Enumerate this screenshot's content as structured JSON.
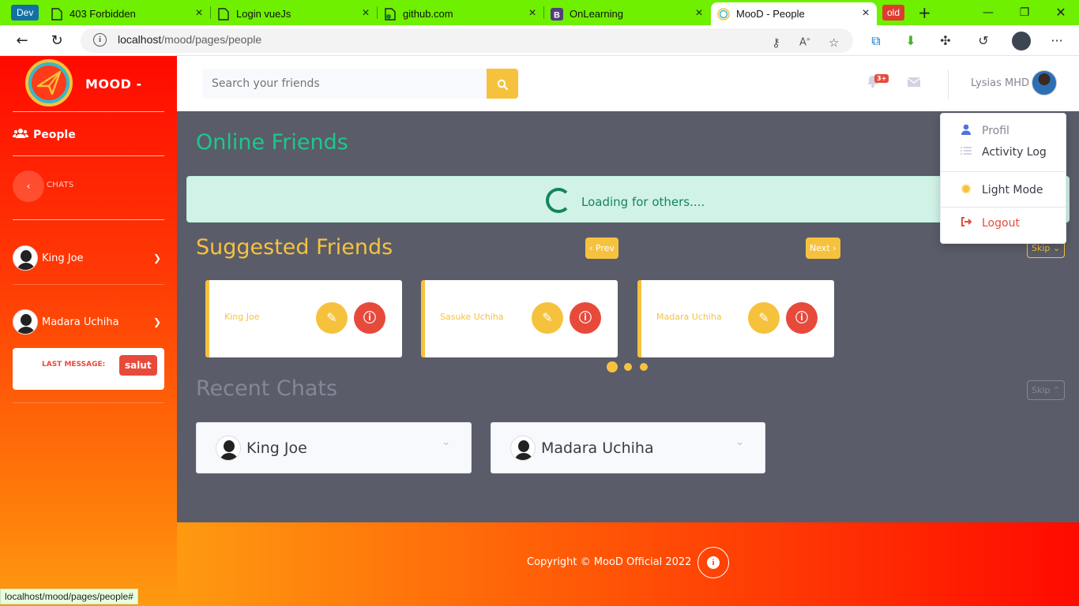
{
  "browser": {
    "dev_badge": "Dev",
    "old_badge": "old",
    "tabs": [
      {
        "title": "403 Forbidden",
        "icon": "page-icon"
      },
      {
        "title": "Login vueJs",
        "icon": "page-icon"
      },
      {
        "title": "github.com",
        "icon": "page-icon"
      },
      {
        "title": "OnLearning",
        "icon": "bootstrap-icon"
      },
      {
        "title": "MooD - People",
        "icon": "mood-icon",
        "active": true
      }
    ],
    "url_host": "localhost",
    "url_path": "/mood/pages/people",
    "status_url": "localhost/mood/pages/people#"
  },
  "sidebar": {
    "brand": "MOOD -",
    "people_label": "People",
    "chats_label": "CHATS",
    "friends": [
      {
        "name": "King Joe"
      },
      {
        "name": "Madara Uchiha"
      }
    ],
    "last_message_label": "LAST MESSAGE:",
    "last_message": "salut"
  },
  "topbar": {
    "search_placeholder": "Search your friends",
    "notification_count": "3+",
    "user_name": "Lysias MHD"
  },
  "dropdown": {
    "items": [
      "Profil",
      "Activity Log",
      "Light Mode",
      "Logout"
    ]
  },
  "main": {
    "online_title": "Online Friends",
    "loading_text": "Loading for others....",
    "suggested_title": "Suggested Friends",
    "prev_label": "Prev",
    "next_label": "Next",
    "skip_label": "Skip",
    "suggested": [
      {
        "name": "King Joe"
      },
      {
        "name": "Sasuke Uchiha"
      },
      {
        "name": "Madara Uchiha"
      }
    ],
    "recent_title": "Recent Chats",
    "recent": [
      {
        "name": "King Joe"
      },
      {
        "name": "Madara Uchiha"
      }
    ]
  },
  "footer": {
    "copyright": "Copyright © MooD Official 2022"
  },
  "colors": {
    "primary_yellow": "#f6c23e",
    "success_green": "#1cc88a",
    "danger_red": "#e74a3b",
    "tabbar_green": "#6ef000",
    "content_bg": "#5a5c69"
  }
}
